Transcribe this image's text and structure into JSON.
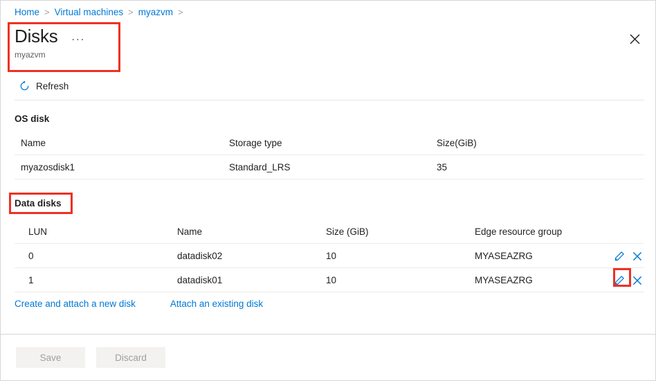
{
  "breadcrumb": {
    "items": [
      {
        "label": "Home",
        "link": true
      },
      {
        "label": "Virtual machines",
        "link": true
      },
      {
        "label": "myazvm",
        "link": true
      }
    ],
    "separator": ">"
  },
  "header": {
    "title": "Disks",
    "subtitle": "myazvm",
    "ellipsis_label": "...",
    "close_icon": "close-icon"
  },
  "command_bar": {
    "refresh_label": "Refresh",
    "refresh_icon": "refresh-icon"
  },
  "os_disk": {
    "section_title": "OS disk",
    "columns": [
      "Name",
      "Storage type",
      "Size(GiB)"
    ],
    "rows": [
      {
        "name": "myazosdisk1",
        "storage_type": "Standard_LRS",
        "size": "35"
      }
    ]
  },
  "data_disks": {
    "section_title": "Data disks",
    "columns": [
      "LUN",
      "Name",
      "Size (GiB)",
      "Edge resource group"
    ],
    "rows": [
      {
        "lun": "0",
        "name": "datadisk02",
        "size": "10",
        "edge_resource_group": "MYASEAZRG"
      },
      {
        "lun": "1",
        "name": "datadisk01",
        "size": "10",
        "edge_resource_group": "MYASEAZRG"
      }
    ],
    "row_action_icons": [
      "edit-pencil-icon",
      "delete-x-icon"
    ]
  },
  "links": {
    "create_and_attach": "Create and attach a new disk",
    "attach_existing": "Attach an existing disk"
  },
  "footer": {
    "save_label": "Save",
    "discard_label": "Discard",
    "save_enabled": false,
    "discard_enabled": false
  },
  "annotations": {
    "highlight_color": "#ee3124",
    "boxes": [
      {
        "target": "page-title-block"
      },
      {
        "target": "data-disks-section-title"
      },
      {
        "target": "edit-pencil-row-2"
      }
    ]
  },
  "colors": {
    "link_blue": "#0078d4",
    "icon_blue": "#0078d4",
    "text_primary": "#201f1e",
    "text_secondary": "#605e5c",
    "disabled_button_bg": "#f3f2f1",
    "disabled_button_text": "#a19f9d",
    "rule": "#e6e6e6"
  }
}
